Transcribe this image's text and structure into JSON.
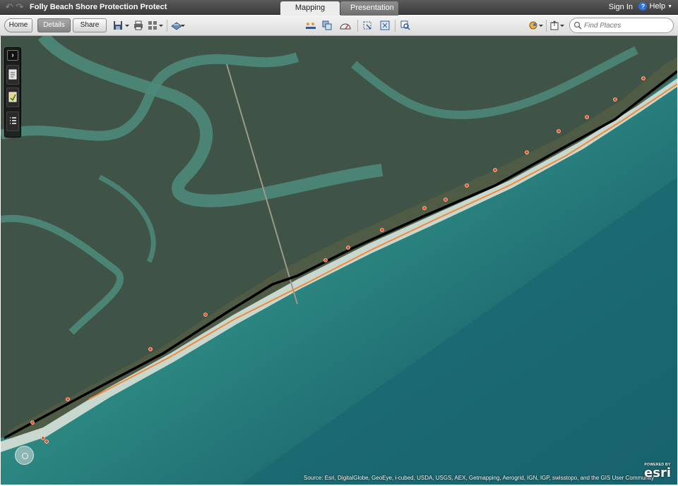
{
  "header": {
    "app_title": "Folly Beach Shore Protection Protect",
    "tabs": [
      {
        "label": "Mapping",
        "active": true
      },
      {
        "label": "Presentation",
        "active": false
      }
    ],
    "sign_in": "Sign In",
    "help": "Help"
  },
  "toolbar": {
    "home": "Home",
    "details": "Details",
    "share": "Share",
    "search_placeholder": "Find Places"
  },
  "map": {
    "attribution": "Source: Esri, DigitalGlobe, GeoEye, i-cubed, USDA, USGS, AEX, Getmapping, Aerogrid, IGN, IGP, swisstopo, and the GIS User Community",
    "logo_powered": "POWERED BY",
    "logo_word": "esri",
    "layer_colors": {
      "shoreline": "#000000",
      "buffer": "#f08a3a",
      "points": "#ff4b1f"
    }
  },
  "icons": [
    "undo-icon",
    "redo-icon",
    "save-icon",
    "print-icon",
    "basemap-icon",
    "share-icon",
    "measure-icon",
    "layers-icon",
    "gauge-icon",
    "select-icon",
    "zoom-select-icon",
    "search-icon",
    "help-icon"
  ]
}
